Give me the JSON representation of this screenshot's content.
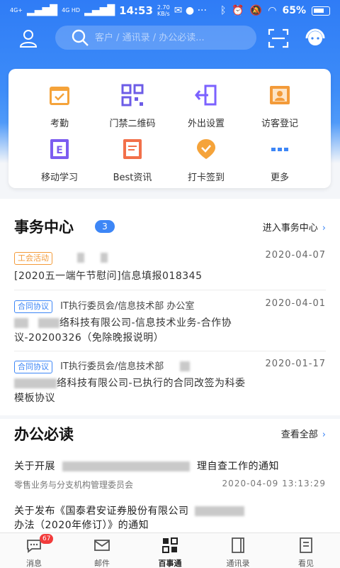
{
  "status": {
    "signal1": "4G+",
    "signal2": "4G HD",
    "time": "14:53",
    "net_speed_value": "2.70",
    "net_speed_unit": "KB/s",
    "battery": "65%"
  },
  "search": {
    "placeholder": "客户 / 通讯录 / 办公必读..."
  },
  "quick_actions": [
    {
      "label": "考勤",
      "icon": "attendance-icon",
      "color": "#f5a33a"
    },
    {
      "label": "门禁二维码",
      "icon": "qr-code-icon",
      "color": "#6c5ce7"
    },
    {
      "label": "外出设置",
      "icon": "exit-icon",
      "color": "#7b61ff"
    },
    {
      "label": "访客登记",
      "icon": "visitor-icon",
      "color": "#f39b3a"
    },
    {
      "label": "移动学习",
      "icon": "e-learning-icon",
      "color": "#7c5cf0"
    },
    {
      "label": "Best资讯",
      "icon": "news-icon",
      "color": "#f2704a"
    },
    {
      "label": "打卡签到",
      "icon": "checkin-icon",
      "color": "#f5a33a"
    },
    {
      "label": "更多",
      "icon": "more-icon",
      "color": "#3d86f6"
    }
  ],
  "affairs": {
    "title": "事务中心",
    "count": "3",
    "link": "进入事务中心",
    "items": [
      {
        "tag": "工会活动",
        "meta": "",
        "date": "2020-04-07",
        "title": "[2020五一端午节慰问]信息填报018345"
      },
      {
        "tag": "合同协议",
        "meta": "IT执行委员会/信息技术部  办公室",
        "date": "2020-04-01",
        "title_a": "络科技有限公司-信息技术业务-合作协",
        "title_b": "议-20200326（免除晚报说明）"
      },
      {
        "tag": "合同协议",
        "meta": "IT执行委员会/信息技术部",
        "date": "2020-01-17",
        "title_a": "络科技有限公司-已执行的合同改签为科委",
        "title_b": "模板协议"
      }
    ]
  },
  "reads": {
    "title": "办公必读",
    "link": "查看全部",
    "items": [
      {
        "title_a": "关于开展",
        "title_b": "理自查工作的通知",
        "meta": "零售业务与分支机构管理委员会",
        "time": "2020-04-09  13:13:29"
      },
      {
        "title_a": "关于发布《国泰君安证券股份有限公司",
        "title_b": "办法（2020年修订）》的通知"
      }
    ]
  },
  "nav": [
    {
      "label": "消息",
      "icon": "message-icon",
      "badge": "67"
    },
    {
      "label": "邮件",
      "icon": "mail-icon"
    },
    {
      "label": "百事通",
      "icon": "grid-apps-icon",
      "active": true
    },
    {
      "label": "通讯录",
      "icon": "contacts-icon"
    },
    {
      "label": "看见",
      "icon": "document-icon"
    }
  ]
}
